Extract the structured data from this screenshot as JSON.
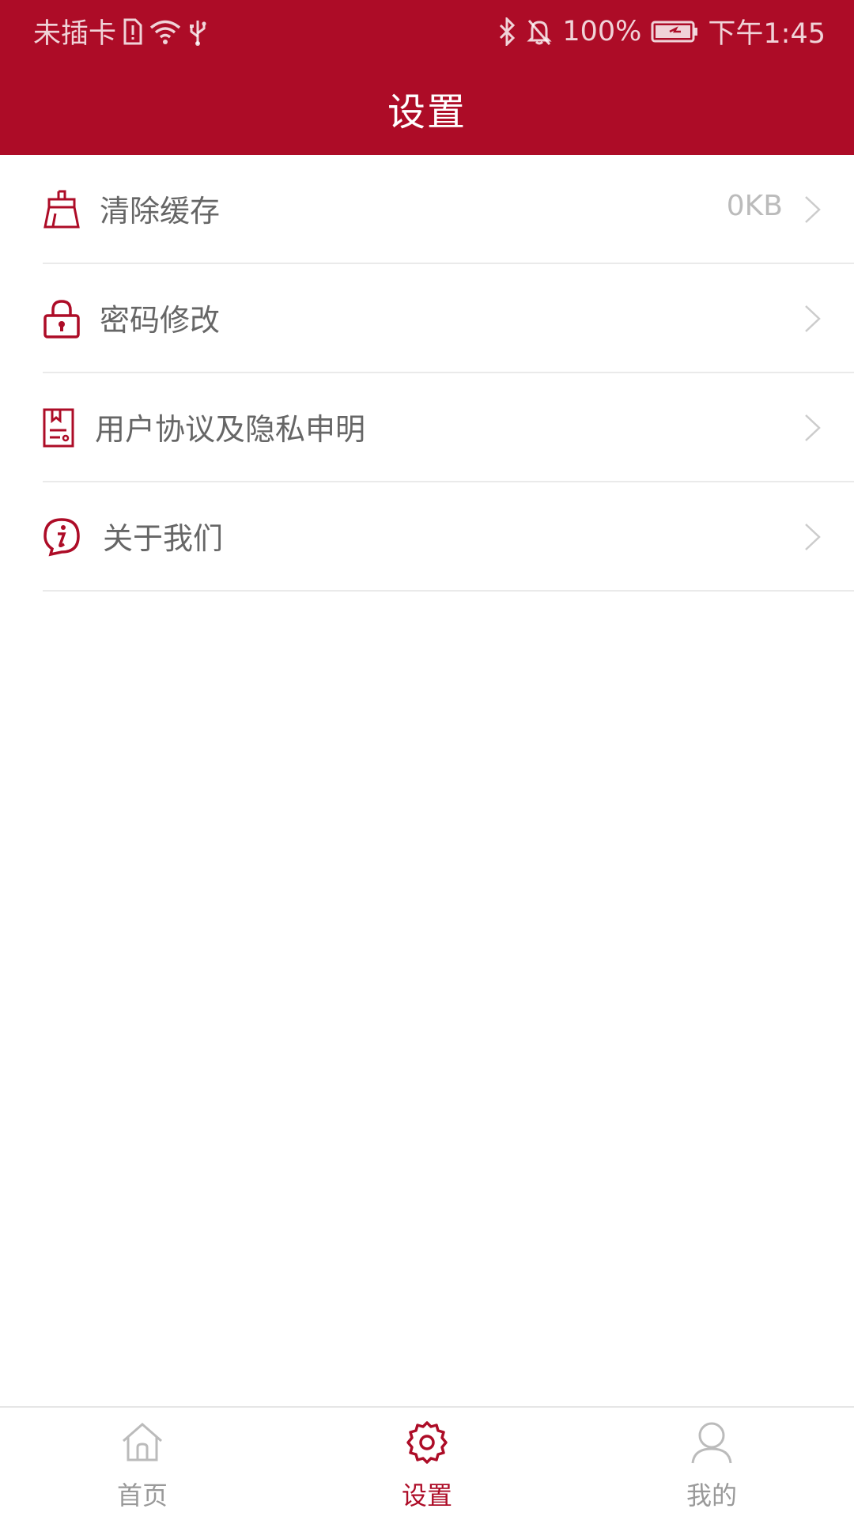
{
  "status_bar": {
    "carrier": "未插卡",
    "battery": "100%",
    "time": "下午1:45"
  },
  "header": {
    "title": "设置"
  },
  "settings": [
    {
      "label": "清除缓存",
      "value": "0KB",
      "icon": "broom-icon"
    },
    {
      "label": "密码修改",
      "value": "",
      "icon": "lock-icon"
    },
    {
      "label": "用户协议及隐私申明",
      "value": "",
      "icon": "document-icon"
    },
    {
      "label": "关于我们",
      "value": "",
      "icon": "info-icon"
    }
  ],
  "tabs": [
    {
      "label": "首页",
      "icon": "home-icon",
      "active": false
    },
    {
      "label": "设置",
      "icon": "gear-icon",
      "active": true
    },
    {
      "label": "我的",
      "icon": "user-icon",
      "active": false
    }
  ],
  "colors": {
    "brand": "#AD0C27",
    "label_text": "#666666",
    "value_text": "#BBBBBB",
    "tab_inactive": "#999999",
    "divider": "#EAEAEA"
  }
}
